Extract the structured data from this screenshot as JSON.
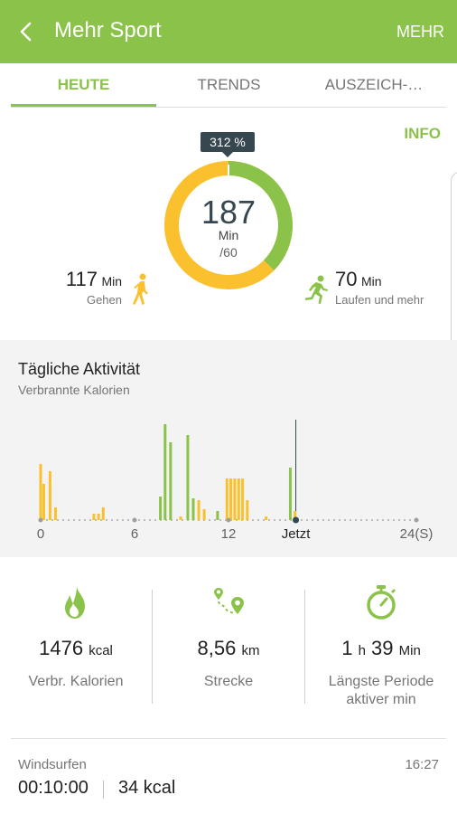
{
  "header": {
    "title": "Mehr Sport",
    "more_label": "MEHR"
  },
  "tabs": [
    {
      "label": "HEUTE",
      "active": true
    },
    {
      "label": "TRENDS",
      "active": false
    },
    {
      "label": "AUSZEICH-…",
      "active": false
    }
  ],
  "summary": {
    "info_label": "INFO",
    "percent_badge": "312 %",
    "total_minutes": "187",
    "minutes_unit": "Min",
    "goal": "/60",
    "walking": {
      "value": "117",
      "unit": "Min",
      "label": "Gehen"
    },
    "running": {
      "value": "70",
      "unit": "Min",
      "label": "Laufen und mehr"
    },
    "ring_fraction_running": 0.374
  },
  "daily_activity": {
    "title": "Tägliche Aktivität",
    "subtitle": "Verbrannte Kalorien"
  },
  "chart_data": {
    "type": "bar",
    "title": "Tägliche Aktivität",
    "subtitle": "Verbrannte Kalorien",
    "x_tick_labels": [
      "0",
      "6",
      "12",
      "Jetzt",
      "24(S)"
    ],
    "x_ticks": [
      0,
      6,
      12,
      16.3,
      24
    ],
    "xlim": [
      0,
      24
    ],
    "current_time": 16.3,
    "series": [
      {
        "color": "#fbc02d",
        "x": [
          0.0,
          0.2,
          0.6,
          0.95,
          3.4,
          3.7,
          4.0,
          8.95,
          10.1,
          10.45,
          11.9,
          12.15,
          12.4,
          12.65,
          12.9,
          13.2,
          14.4,
          16.25
        ],
        "values": [
          62,
          40,
          54,
          14,
          7,
          7,
          14,
          4,
          22,
          12,
          46,
          46,
          46,
          46,
          46,
          22,
          4,
          10
        ]
      },
      {
        "color": "#8bc34a",
        "x": [
          7.65,
          7.95,
          8.3,
          9.4,
          9.75,
          11.3,
          15.95
        ],
        "values": [
          26,
          106,
          86,
          94,
          24,
          10,
          58
        ]
      }
    ],
    "grid": false,
    "legend": "none"
  },
  "stats": [
    {
      "icon": "flame-icon",
      "value": "1476",
      "unit": "kcal",
      "label": "Verbr. Kalorien"
    },
    {
      "icon": "route-icon",
      "value": "8,56",
      "unit": "km",
      "label": "Strecke"
    },
    {
      "icon": "stopwatch-icon",
      "value_h": "1",
      "unit_h": "h",
      "value_m": "39",
      "unit_m": "Min",
      "label": "Längste Periode aktiver min"
    }
  ],
  "log_entry": {
    "activity": "Windsurfen",
    "time": "16:27",
    "duration": "00:10:00",
    "calories": "34 kcal"
  },
  "colors": {
    "accent": "#8bc34a",
    "walking": "#fbc02d",
    "running": "#8bc34a",
    "dark": "#37474f"
  }
}
